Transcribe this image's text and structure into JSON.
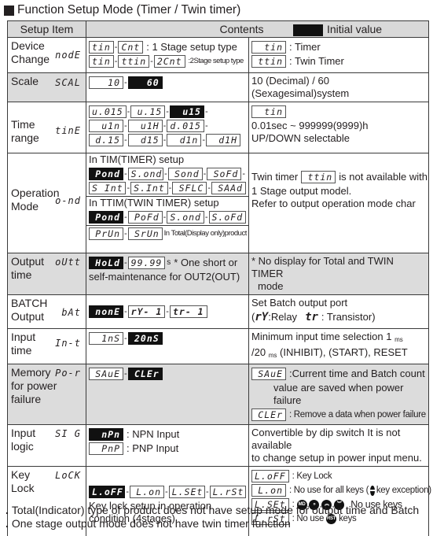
{
  "title": "Function Setup Mode (Timer / Twin timer)",
  "header": {
    "setup_item": "Setup Item",
    "contents": "Contents",
    "initial_value": "Initial value"
  },
  "rows": {
    "device_change": {
      "label1": "Device",
      "label2": "Change",
      "code": "nodE",
      "line1": {
        "a": "tin",
        "b": "Cnt",
        "text": ": 1 Stage setup type"
      },
      "line2": {
        "a": "tin",
        "b": "ttin",
        "c": "2Cnt",
        "text": ":2Stage setup type"
      },
      "info1": {
        "seg": "tin",
        "text": ": Timer"
      },
      "info2": {
        "seg": "ttin",
        "text": ": Twin Timer"
      }
    },
    "scale": {
      "label": "Scale",
      "code": "SCAL",
      "a": "10",
      "b": "60",
      "info": "10 (Decimal) / 60 (Sexagesimal)system"
    },
    "time_range": {
      "label1": "Time",
      "label2": "range",
      "code": "tinE",
      "r1": [
        "u.015",
        "u.15",
        "u15"
      ],
      "r2": [
        "u1n",
        "u1H",
        "d.015"
      ],
      "r3": [
        "d.15",
        "d15",
        "d1n",
        "d1H"
      ],
      "info_seg": "tin",
      "info1": "0.01sec ~ 999999(9999)h",
      "info2": "UP/DOWN selectable"
    },
    "operation_mode": {
      "label1": "Operation",
      "label2": "Mode",
      "code": "o-nd",
      "tim_title": "In TIM(TIMER) setup",
      "tim_r1": [
        "Pond",
        "S.ond",
        "Sond",
        "SoFd"
      ],
      "tim_r2": [
        "S Int",
        "S.Int",
        "SFLC",
        "SAAd"
      ],
      "ttim_title": "In TTIM(TWIN TIMER) setup",
      "ttim_r1": [
        "Pond",
        "PoFd",
        "S.ond",
        "S.oFd"
      ],
      "total_r": [
        "PrUn",
        "SrUn"
      ],
      "total_text": "In Total(Display only)product",
      "info_pre": "Twin timer",
      "info_seg": "ttin",
      "info_post": "is not available with",
      "info2": "1 Stage output model.",
      "info3": "Refer to output operation mode char"
    },
    "output_time": {
      "label1": "Output",
      "label2": "time",
      "code": "oUtt",
      "a": "HoLd",
      "b": "99.99",
      "unit": "s",
      "text1": "* One short or",
      "text2": "self-maintenance for OUT2(OUT)",
      "info1": "* No display for Total and TWIN TIMER",
      "info2": "mode"
    },
    "batch_output": {
      "label1": "BATCH",
      "label2": "Output",
      "code": "bAt",
      "a": "nonE",
      "b": "rY- 1",
      "c": "tr- 1",
      "info1": "Set Batch output port",
      "relay_seg": "rY",
      "relay_text": ":Relay",
      "trans_seg": "tr",
      "trans_text": ": Transistor)"
    },
    "input_time": {
      "label1": "Input",
      "label2": "time",
      "code": "In-t",
      "a": "1nS",
      "b": "20nS",
      "info1": "Minimum input time selection 1",
      "info2_a": "/20",
      "info2_b": "(INHIBIT), (START), RESET",
      "unit": "ms"
    },
    "memory": {
      "label1": "Memory",
      "label2": "for power",
      "label3": "failure",
      "code": "Po-r",
      "a": "SAuE",
      "b": "CLEr",
      "info1_seg": "SAuE",
      "info1": ":Current time and Batch count",
      "info1b": "value are saved when power failure",
      "info2_seg": "CLEr",
      "info2": ": Remove a data when power failure"
    },
    "input_logic": {
      "label1": "Input",
      "label2": "logic",
      "code": "SI G",
      "a": "nPn",
      "a_text": ": NPN Input",
      "b": "PnP",
      "b_text": ": PNP Input",
      "info1": "Convertible by dip switch It is not available",
      "info2": "to change setup in power input menu."
    },
    "key_lock": {
      "label1": "Key",
      "label2": "Lock",
      "code": "LoCK",
      "segs": [
        "L.oFF",
        "L.on",
        "L.SEt",
        "L.rSt"
      ],
      "text1": "Key lock setup in operation",
      "text2": "condition (4stages)",
      "info": [
        {
          "seg": "L.oFF",
          "text": ": Key Lock"
        },
        {
          "seg": "L.on",
          "text_a": ": No use for all keys (",
          "icon": "ent-key-icon",
          "icon_text": "▬",
          "text_b": "key exception)"
        },
        {
          "seg": "L.SEt",
          "text_a": ":",
          "icons": [
            "MD",
            "»",
            "︽",
            "︾"
          ],
          "text_b": "No use keys"
        },
        {
          "seg": "L.rSt",
          "text_a": ": No use",
          "icon_text": "RST",
          "text_b": "keys"
        }
      ]
    }
  },
  "notes": [
    "Total(Indicator) type of product does not have setup mode for output time and Batch",
    "One stage output mode does not have twin timer function"
  ]
}
